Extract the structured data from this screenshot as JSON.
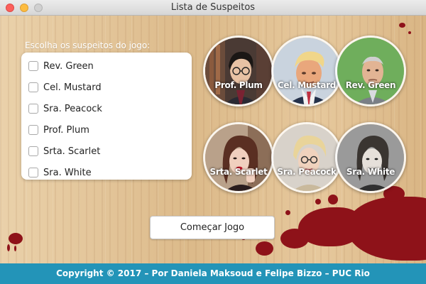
{
  "window": {
    "title": "Lista de Suspeitos"
  },
  "prompt": "Escolha os suspeitos do jogo:",
  "suspects_list": [
    {
      "label": "Rev. Green",
      "checked": false
    },
    {
      "label": "Cel. Mustard",
      "checked": false
    },
    {
      "label": "Sra. Peacock",
      "checked": false
    },
    {
      "label": "Prof. Plum",
      "checked": false
    },
    {
      "label": "Srta. Scarlet",
      "checked": false
    },
    {
      "label": "Sra. White",
      "checked": false
    }
  ],
  "portraits": [
    {
      "name": "Prof. Plum"
    },
    {
      "name": "Cel. Mustard"
    },
    {
      "name": "Rev. Green"
    },
    {
      "name": "Srta. Scarlet"
    },
    {
      "name": "Sra. Peacock"
    },
    {
      "name": "Sra. White"
    }
  ],
  "start_button": "Começar Jogo",
  "footer": "Copyright © 2017 – Por Daniela Maksoud e Felipe Bizzo – PUC Rio",
  "colors": {
    "footer_bg": "#2394b8",
    "blood": "#8e1219",
    "wood": "#e0c295"
  }
}
